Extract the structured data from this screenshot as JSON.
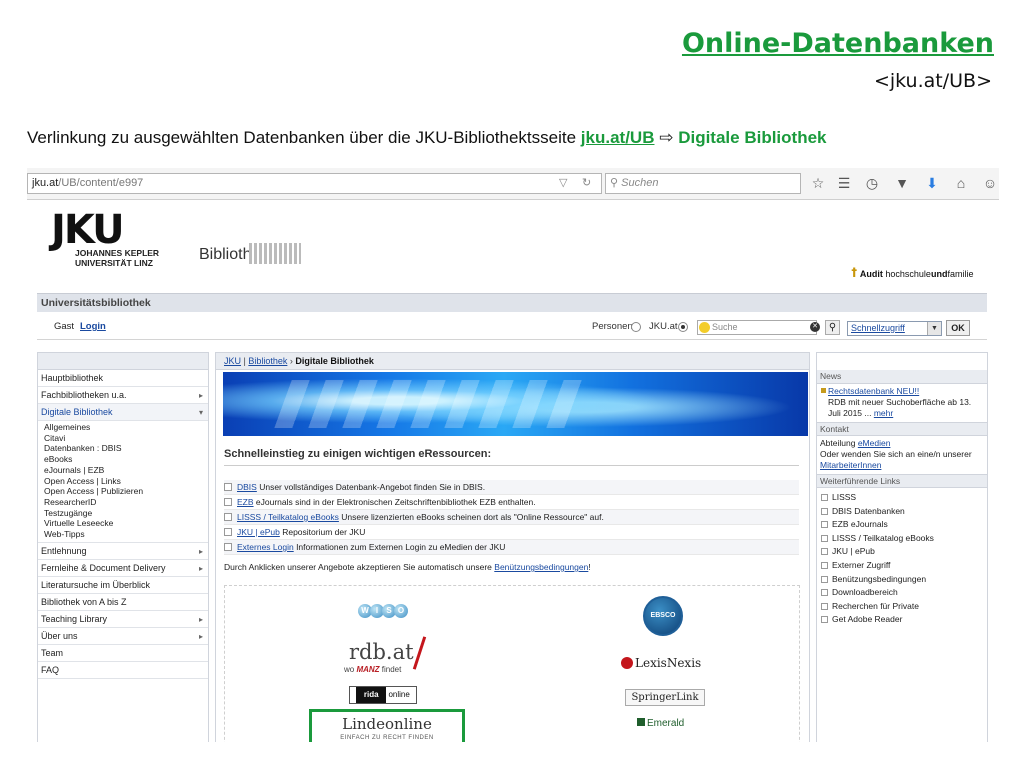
{
  "slide": {
    "title": "Online-Datenbanken",
    "subtitle": "<jku.at/UB>",
    "desc_text": "Verlinkung zu ausgewählten Datenbanken über die JKU-Bibliothektsseite ",
    "desc_link": "jku.at/UB",
    "desc_arrow": "⇨",
    "desc_target": "Digitale Bibliothek"
  },
  "browser": {
    "url_host": "jku.at",
    "url_path": "/UB/content/e997",
    "search_placeholder": "Suchen",
    "icons": [
      "star-icon",
      "reading-list-icon",
      "history-icon",
      "pocket-icon",
      "download-icon",
      "home-icon",
      "chat-icon"
    ]
  },
  "header": {
    "logo": "JKU",
    "logo_sub_line1": "JOHANNES KEPLER",
    "logo_sub_line2": "UNIVERSITÄT LINZ",
    "bibliothek": "Bibliothek",
    "audit_label": "Audit",
    "audit_org": "hochschule",
    "audit_bold": "und",
    "audit_end": "familie"
  },
  "ub_bar": {
    "title": "Universitätsbibliothek",
    "gast": "Gast",
    "login": "Login",
    "radio_personen": "Personen",
    "radio_jku": "JKU.at",
    "search_placeholder": "Suche",
    "quick_select": "Schnellzugriff",
    "ok": "OK"
  },
  "leftnav": {
    "items": [
      {
        "label": "Hauptbibliothek",
        "chev": ""
      },
      {
        "label": "Fachbibliotheken u.a.",
        "chev": "▸"
      },
      {
        "label": "Digitale Bibliothek",
        "chev": "▾"
      }
    ],
    "subitems": [
      "Allgemeines",
      "Citavi",
      "Datenbanken : DBIS",
      "eBooks",
      "eJournals | EZB",
      "Open Access | Links",
      "Open Access | Publizieren",
      "ResearcherID",
      "Testzugänge",
      "Virtuelle Leseecke",
      "Web-Tipps"
    ],
    "items2": [
      {
        "label": "Entlehnung",
        "chev": "▸"
      },
      {
        "label": "Fernleihe & Document Delivery",
        "chev": "▸"
      },
      {
        "label": "Literatursuche im Überblick",
        "chev": ""
      },
      {
        "label": "Bibliothek von A bis Z",
        "chev": ""
      },
      {
        "label": "Teaching Library",
        "chev": "▸"
      },
      {
        "label": "Über uns",
        "chev": "▸"
      },
      {
        "label": "Team",
        "chev": ""
      },
      {
        "label": "FAQ",
        "chev": ""
      }
    ]
  },
  "center": {
    "crumb_jku": "JKU",
    "crumb_sep": " | ",
    "crumb_bib": "Bibliothek",
    "crumb_arrow": " › ",
    "crumb_current": "Digitale Bibliothek",
    "section_head": "Schnelleinstieg zu einigen wichtigen eRessourcen:",
    "rows": [
      {
        "link": "DBIS",
        "text": " Unser vollständiges Datenbank-Angebot finden Sie in DBIS."
      },
      {
        "link": "EZB",
        "text": " eJournals sind in der Elektronischen Zeitschriftenbibliothek EZB enthalten."
      },
      {
        "link": "LISSS / Teilkatalog eBooks",
        "text": " Unsere lizenzierten eBooks scheinen dort als \"Online Ressource\" auf."
      },
      {
        "link": "JKU | ePub",
        "text": " Repositorium der JKU"
      },
      {
        "link": "Externes Login",
        "text": " Informationen zum Externen Login zu eMedien der JKU"
      }
    ],
    "note_text": "Durch Anklicken unserer Angebote akzeptieren Sie automatisch unsere ",
    "note_link": "Benützungsbedingungen",
    "note_end": "!",
    "logos": {
      "wiso_letters": [
        "W",
        "I",
        "S",
        "O"
      ],
      "ebsco": "EBSCO",
      "rdb": "rdb.at",
      "rdb_sub_pre": "wo ",
      "rdb_sub_brand": "MANZ",
      "rdb_sub_post": " findet",
      "lexis": "LexisNexis",
      "rida_brand": "rida",
      "rida_online": "online",
      "springer": "SpringerLink",
      "linde": "Lindeonline",
      "linde_sub": "EINFACH ZU RECHT FINDEN",
      "emerald": "Emerald"
    }
  },
  "right": {
    "news_head": "News",
    "news_link": "Rechtsdatenbank NEU!!",
    "news_text": "RDB mit neuer Suchoberfläche ab 13. Juli 2015 ... ",
    "news_more": "mehr",
    "kontakt_head": "Kontakt",
    "kontakt_pre": "Abteilung ",
    "kontakt_link": "eMedien",
    "kontakt_text": "Oder wenden Sie sich an eine/n unserer ",
    "kontakt_link2": "MitarbeiterInnen",
    "links_head": "Weiterführende Links",
    "links": [
      "LISSS",
      "DBIS Datenbanken",
      "EZB eJournals",
      "LISSS / Teilkatalog eBooks",
      "JKU | ePub",
      "Externer Zugriff",
      "Benützungsbedingungen",
      "Downloadbereich",
      "Recherchen für Private",
      "Get Adobe Reader"
    ]
  }
}
